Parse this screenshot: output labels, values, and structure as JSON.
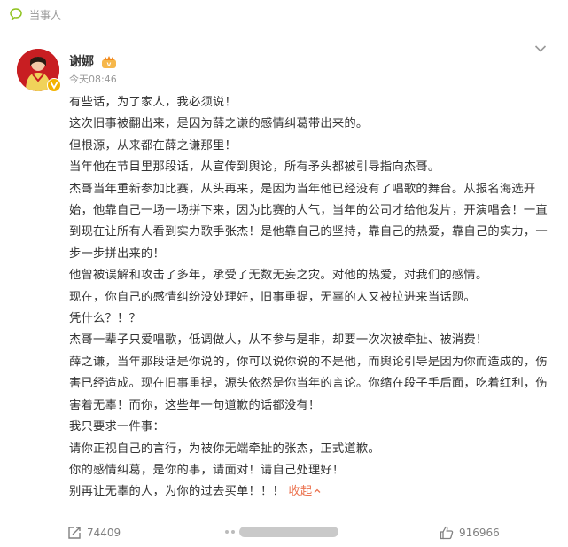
{
  "topbar": {
    "label": "当事人",
    "icon": "chat-bubble-icon"
  },
  "post": {
    "author": "谢娜",
    "time": "今天08:46",
    "paragraphs": [
      "有些话，为了家人，我必须说！",
      "这次旧事被翻出来，是因为薛之谦的感情纠葛带出来的。",
      "但根源，从来都在薛之谦那里！",
      "当年他在节目里那段话，从宣传到舆论，所有矛头都被引导指向杰哥。",
      "杰哥当年重新参加比赛，从头再来，是因为当年他已经没有了唱歌的舞台。从报名海选开始，他靠自己一场一场拼下来，因为比赛的人气，当年的公司才给他发片，开演唱会！一直到现在让所有人看到实力歌手张杰！是他靠自己的坚持，靠自己的热爱，靠自己的实力，一步一步拼出来的！",
      "他曾被误解和攻击了多年，承受了无数无妄之灾。对他的热爱，对我们的感情。",
      "现在，你自己的感情纠纷没处理好，旧事重提，无辜的人又被拉进来当话题。",
      "凭什么？！？",
      "杰哥一辈子只爱唱歌，低调做人，从不参与是非，却要一次次被牵扯、被消费！",
      "薛之谦，当年那段话是你说的，你可以说你说的不是他，而舆论引导是因为你而造成的，伤害已经造成。现在旧事重提，源头依然是你当年的言论。你缩在段子手后面，吃着红利，伤害着无辜！而你，这些年一句道歉的话都没有！",
      "我只要求一件事：",
      "请你正视自己的言行，为被你无端牵扯的张杰，正式道歉。",
      "你的感情纠葛，是你的事，请面对！请自己处理好！",
      "别再让无辜的人，为你的过去买单！！！"
    ],
    "collapse_label": "收起"
  },
  "actions": {
    "repost_count": "74409",
    "like_count": "916966"
  },
  "colors": {
    "accent": "#eb7350",
    "avatar_bg": "#c81e22",
    "verified_badge": "#f3b300",
    "muted_text": "#999999"
  }
}
